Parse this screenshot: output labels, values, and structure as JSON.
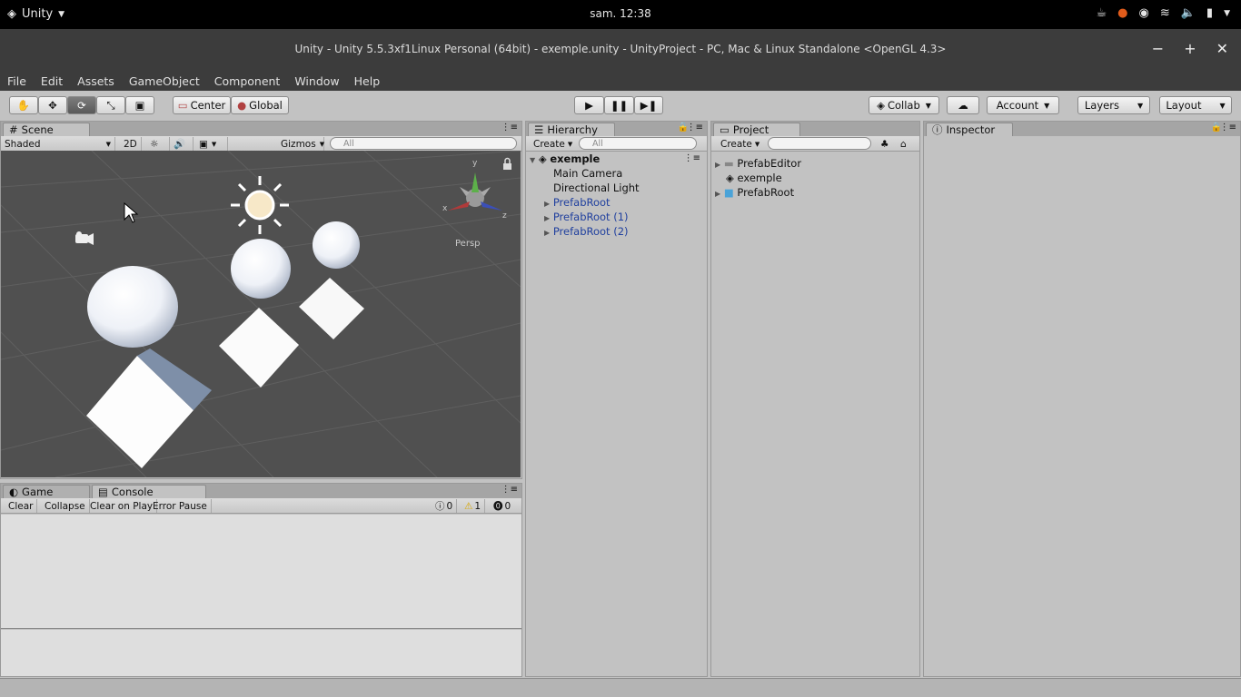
{
  "os": {
    "app_name": "Unity",
    "clock": "sam. 12:38"
  },
  "window": {
    "title": "Unity - Unity 5.5.3xf1Linux Personal (64bit) - exemple.unity - UnityProject - PC, Mac & Linux Standalone <OpenGL 4.3>"
  },
  "menu": [
    "File",
    "Edit",
    "Assets",
    "GameObject",
    "Component",
    "Window",
    "Help"
  ],
  "toolbar": {
    "pivot": "Center",
    "space": "Global",
    "collab": "Collab",
    "account": "Account",
    "layers": "Layers",
    "layout": "Layout"
  },
  "scene": {
    "tab": "Scene",
    "shading": "Shaded",
    "mode_2d": "2D",
    "gizmos": "Gizmos",
    "search_placeholder": "All",
    "persp": "Persp",
    "axis_y": "y",
    "axis_x": "x",
    "axis_z": "z"
  },
  "bottom": {
    "tab_game": "Game",
    "tab_console": "Console",
    "clear": "Clear",
    "collapse": "Collapse",
    "clear_on_play": "Clear on Play",
    "error_pause": "Error Pause",
    "info_count": "0",
    "warn_count": "1",
    "error_count": "0"
  },
  "hierarchy": {
    "tab": "Hierarchy",
    "create": "Create",
    "search_placeholder": "All",
    "scene_name": "exemple",
    "items": [
      {
        "label": "Main Camera"
      },
      {
        "label": "Directional Light"
      },
      {
        "label": "PrefabRoot"
      },
      {
        "label": "PrefabRoot (1)"
      },
      {
        "label": "PrefabRoot (2)"
      }
    ]
  },
  "project": {
    "tab": "Project",
    "create": "Create",
    "items": [
      {
        "label": "PrefabEditor"
      },
      {
        "label": "exemple"
      },
      {
        "label": "PrefabRoot"
      }
    ]
  },
  "inspector": {
    "tab": "Inspector"
  }
}
